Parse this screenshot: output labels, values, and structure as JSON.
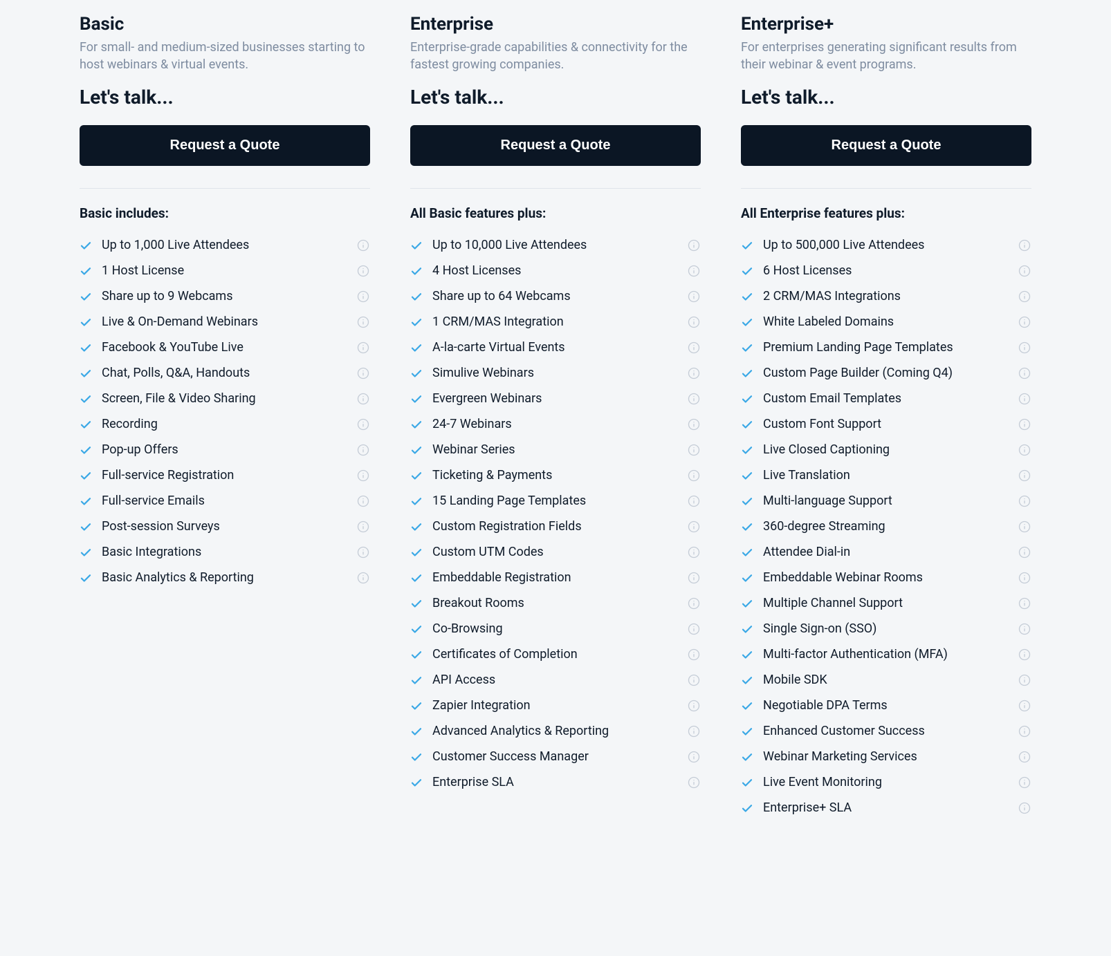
{
  "plans": [
    {
      "title": "Basic",
      "desc": "For small- and medium-sized businesses starting to host webinars & virtual events.",
      "talk": "Let's talk...",
      "button": "Request a Quote",
      "features_heading": "Basic includes:",
      "features": [
        "Up to 1,000 Live Attendees",
        "1 Host License",
        "Share up to 9 Webcams",
        "Live & On-Demand Webinars",
        "Facebook & YouTube Live",
        "Chat, Polls, Q&A, Handouts",
        "Screen, File & Video Sharing",
        "Recording",
        "Pop-up Offers",
        "Full-service Registration",
        "Full-service Emails",
        "Post-session Surveys",
        "Basic Integrations",
        "Basic Analytics & Reporting"
      ]
    },
    {
      "title": "Enterprise",
      "desc": "Enterprise-grade capabilities & connectivity for the fastest growing companies.",
      "talk": "Let's talk...",
      "button": "Request a Quote",
      "features_heading": "All Basic features plus:",
      "features": [
        "Up to 10,000 Live Attendees",
        "4 Host Licenses",
        "Share up to 64 Webcams",
        "1 CRM/MAS Integration",
        "A-la-carte Virtual Events",
        "Simulive Webinars",
        "Evergreen Webinars",
        "24-7 Webinars",
        "Webinar Series",
        "Ticketing & Payments",
        "15 Landing Page Templates",
        "Custom Registration Fields",
        "Custom UTM Codes",
        "Embeddable Registration",
        "Breakout Rooms",
        "Co-Browsing",
        "Certificates of Completion",
        "API Access",
        "Zapier Integration",
        "Advanced Analytics & Reporting",
        "Customer Success Manager",
        "Enterprise SLA"
      ]
    },
    {
      "title": "Enterprise+",
      "desc": "For enterprises generating significant results from their webinar & event programs.",
      "talk": "Let's talk...",
      "button": "Request a Quote",
      "features_heading": "All Enterprise features plus:",
      "features": [
        "Up to 500,000 Live Attendees",
        "6 Host Licenses",
        "2 CRM/MAS Integrations",
        "White Labeled Domains",
        "Premium Landing Page Templates",
        "Custom Page Builder (Coming Q4)",
        "Custom Email Templates",
        "Custom Font Support",
        "Live Closed Captioning",
        "Live Translation",
        "Multi-language Support",
        "360-degree Streaming",
        "Attendee Dial-in",
        "Embeddable Webinar Rooms",
        "Multiple Channel Support",
        "Single Sign-on (SSO)",
        "Multi-factor Authentication (MFA)",
        "Mobile SDK",
        "Negotiable DPA Terms",
        "Enhanced Customer Success",
        "Webinar Marketing Services",
        "Live Event Monitoring",
        "Enterprise+ SLA"
      ]
    }
  ]
}
